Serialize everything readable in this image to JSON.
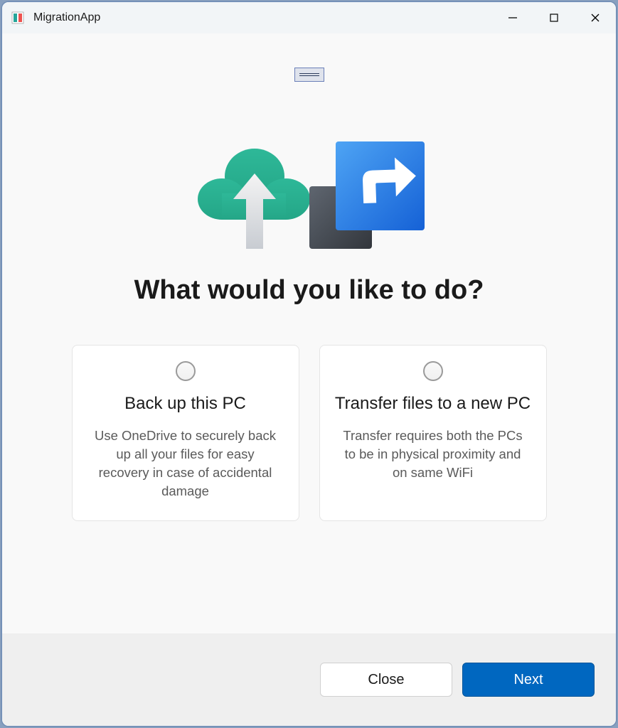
{
  "window": {
    "title": "MigrationApp"
  },
  "main": {
    "heading": "What would you like to do?",
    "options": [
      {
        "title": "Back up this PC",
        "description": "Use OneDrive to securely back up all your files for easy recovery in case of accidental damage"
      },
      {
        "title": "Transfer files to a new PC",
        "description": "Transfer requires both the PCs to be in physical proximity and on same WiFi"
      }
    ]
  },
  "footer": {
    "close_label": "Close",
    "next_label": "Next"
  }
}
